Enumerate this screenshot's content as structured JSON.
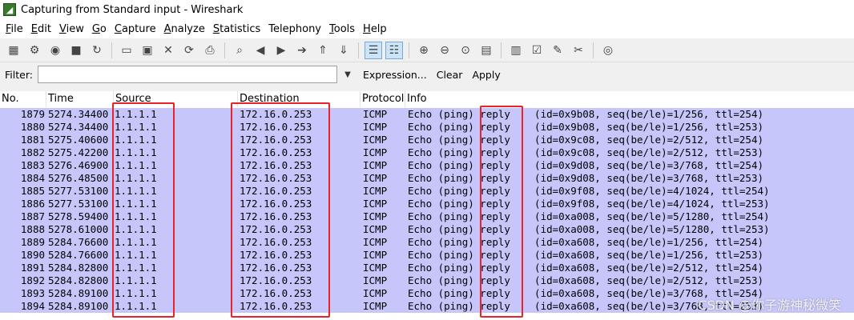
{
  "window": {
    "title": "Capturing from Standard input - Wireshark",
    "icon": "wireshark-fin-icon"
  },
  "menu": [
    {
      "label": "File",
      "u": "F",
      "rest": "ile"
    },
    {
      "label": "Edit",
      "u": "E",
      "rest": "dit"
    },
    {
      "label": "View",
      "u": "V",
      "rest": "iew"
    },
    {
      "label": "Go",
      "u": "G",
      "rest": "o"
    },
    {
      "label": "Capture",
      "u": "C",
      "rest": "apture"
    },
    {
      "label": "Analyze",
      "u": "A",
      "rest": "nalyze"
    },
    {
      "label": "Statistics",
      "u": "S",
      "rest": "tatistics"
    },
    {
      "label": "Telephony",
      "u": "",
      "rest": "Telephony"
    },
    {
      "label": "Tools",
      "u": "T",
      "rest": "ools"
    },
    {
      "label": "Help",
      "u": "H",
      "rest": "elp"
    }
  ],
  "toolbar": {
    "icons": [
      "interface-list-icon",
      "capture-options-icon",
      "start-capture-icon",
      "stop-capture-icon",
      "restart-capture-icon",
      "sep",
      "open-file-icon",
      "save-file-icon",
      "close-file-icon",
      "reload-icon",
      "print-icon",
      "sep",
      "find-packet-icon",
      "go-back-icon",
      "go-forward-icon",
      "go-to-packet-icon",
      "go-first-icon",
      "go-last-icon",
      "sep",
      "colorize-icon",
      "auto-scroll-icon",
      "sep",
      "zoom-in-icon",
      "zoom-out-icon",
      "zoom-normal-icon",
      "resize-columns-icon",
      "sep",
      "capture-filters-icon",
      "display-filters-icon",
      "coloring-rules-icon",
      "preferences-icon",
      "sep",
      "help-icon"
    ]
  },
  "filter": {
    "label": "Filter:",
    "value": "",
    "expression": "Expression...",
    "clear": "Clear",
    "apply": "Apply"
  },
  "columns": [
    "No.",
    "Time",
    "Source",
    "Destination",
    "Protocol",
    "Info"
  ],
  "rows": [
    {
      "no": "1879",
      "time": "5274.34400",
      "src": "1.1.1.1",
      "dst": "172.16.0.253",
      "proto": "ICMP",
      "info": "Echo (ping) reply    (id=0x9b08, seq(be/le)=1/256, ttl=254)"
    },
    {
      "no": "1880",
      "time": "5274.34400",
      "src": "1.1.1.1",
      "dst": "172.16.0.253",
      "proto": "ICMP",
      "info": "Echo (ping) reply    (id=0x9b08, seq(be/le)=1/256, ttl=253)"
    },
    {
      "no": "1881",
      "time": "5275.40600",
      "src": "1.1.1.1",
      "dst": "172.16.0.253",
      "proto": "ICMP",
      "info": "Echo (ping) reply    (id=0x9c08, seq(be/le)=2/512, ttl=254)"
    },
    {
      "no": "1882",
      "time": "5275.42200",
      "src": "1.1.1.1",
      "dst": "172.16.0.253",
      "proto": "ICMP",
      "info": "Echo (ping) reply    (id=0x9c08, seq(be/le)=2/512, ttl=253)"
    },
    {
      "no": "1883",
      "time": "5276.46900",
      "src": "1.1.1.1",
      "dst": "172.16.0.253",
      "proto": "ICMP",
      "info": "Echo (ping) reply    (id=0x9d08, seq(be/le)=3/768, ttl=254)"
    },
    {
      "no": "1884",
      "time": "5276.48500",
      "src": "1.1.1.1",
      "dst": "172.16.0.253",
      "proto": "ICMP",
      "info": "Echo (ping) reply    (id=0x9d08, seq(be/le)=3/768, ttl=253)"
    },
    {
      "no": "1885",
      "time": "5277.53100",
      "src": "1.1.1.1",
      "dst": "172.16.0.253",
      "proto": "ICMP",
      "info": "Echo (ping) reply    (id=0x9f08, seq(be/le)=4/1024, ttl=254)"
    },
    {
      "no": "1886",
      "time": "5277.53100",
      "src": "1.1.1.1",
      "dst": "172.16.0.253",
      "proto": "ICMP",
      "info": "Echo (ping) reply    (id=0x9f08, seq(be/le)=4/1024, ttl=253)"
    },
    {
      "no": "1887",
      "time": "5278.59400",
      "src": "1.1.1.1",
      "dst": "172.16.0.253",
      "proto": "ICMP",
      "info": "Echo (ping) reply    (id=0xa008, seq(be/le)=5/1280, ttl=254)"
    },
    {
      "no": "1888",
      "time": "5278.61000",
      "src": "1.1.1.1",
      "dst": "172.16.0.253",
      "proto": "ICMP",
      "info": "Echo (ping) reply    (id=0xa008, seq(be/le)=5/1280, ttl=253)"
    },
    {
      "no": "1889",
      "time": "5284.76600",
      "src": "1.1.1.1",
      "dst": "172.16.0.253",
      "proto": "ICMP",
      "info": "Echo (ping) reply    (id=0xa608, seq(be/le)=1/256, ttl=254)"
    },
    {
      "no": "1890",
      "time": "5284.76600",
      "src": "1.1.1.1",
      "dst": "172.16.0.253",
      "proto": "ICMP",
      "info": "Echo (ping) reply    (id=0xa608, seq(be/le)=1/256, ttl=253)"
    },
    {
      "no": "1891",
      "time": "5284.82800",
      "src": "1.1.1.1",
      "dst": "172.16.0.253",
      "proto": "ICMP",
      "info": "Echo (ping) reply    (id=0xa608, seq(be/le)=2/512, ttl=254)"
    },
    {
      "no": "1892",
      "time": "5284.82800",
      "src": "1.1.1.1",
      "dst": "172.16.0.253",
      "proto": "ICMP",
      "info": "Echo (ping) reply    (id=0xa608, seq(be/le)=2/512, ttl=253)"
    },
    {
      "no": "1893",
      "time": "5284.89100",
      "src": "1.1.1.1",
      "dst": "172.16.0.253",
      "proto": "ICMP",
      "info": "Echo (ping) reply    (id=0xa608, seq(be/le)=3/768, ttl=254)"
    },
    {
      "no": "1894",
      "time": "5284.89100",
      "src": "1.1.1.1",
      "dst": "172.16.0.253",
      "proto": "ICMP",
      "info": "Echo (ping) reply    (id=0xa608, seq(be/le)=3/768, ttl=253)"
    }
  ],
  "colors": {
    "row_bg": "#c6c6fb",
    "highlight": "#e8232a"
  },
  "watermark": "CSDN @你子游神秘微笑"
}
